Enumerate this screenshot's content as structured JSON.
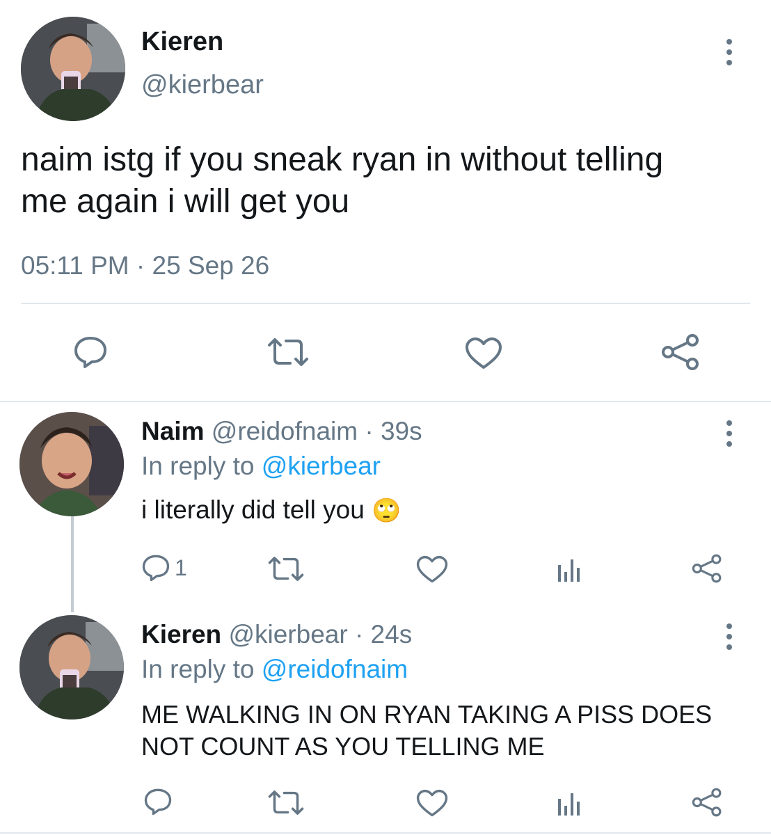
{
  "main_tweet": {
    "author_name": "Kieren",
    "author_handle": "@kierbear",
    "text_line1": "naim istg if you sneak ryan in without telling",
    "text_line2": "me again i will get you",
    "timestamp": "05:11 PM · 25 Sep 26"
  },
  "replies": [
    {
      "author_name": "Naim",
      "meta": "@reidofnaim · 39s",
      "reply_prefix": "In reply to ",
      "reply_handle": "@kierbear",
      "text": "i literally did tell you",
      "emoji": "🙄",
      "reply_count": "1"
    },
    {
      "author_name": "Kieren",
      "meta": "@kierbear · 24s",
      "reply_prefix": "In reply to ",
      "reply_handle": "@reidofnaim",
      "text_line1": "ME WALKING IN ON RYAN TAKING A PISS DOES",
      "text_line2": "NOT COUNT AS YOU TELLING ME",
      "reply_count": ""
    }
  ],
  "colors": {
    "link": "#1da1f2",
    "muted": "#657786",
    "divider": "#e1e8ed",
    "text": "#14171a"
  },
  "icons": {
    "reply": "reply-bubble-icon",
    "retweet": "retweet-icon",
    "like": "heart-icon",
    "share": "share-icon",
    "analytics": "analytics-bars-icon",
    "more": "more-vertical-icon"
  }
}
